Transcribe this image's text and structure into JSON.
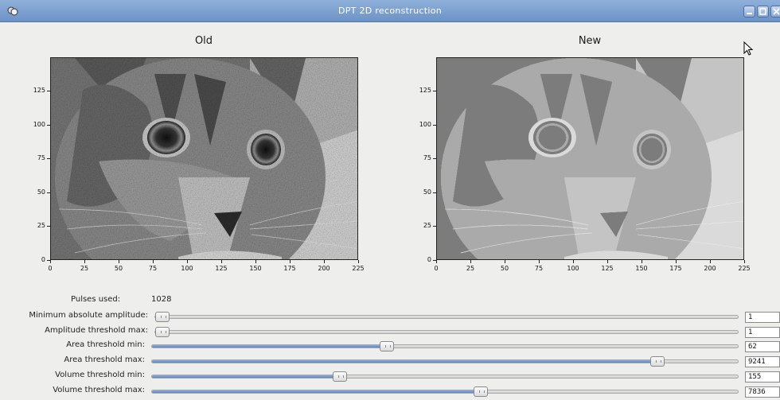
{
  "window": {
    "title": "DPT 2D reconstruction",
    "icons": {
      "app": "app-icon",
      "minimize": "minimize-icon",
      "maximize": "maximize-icon",
      "close": "close-icon"
    }
  },
  "plots": {
    "old": {
      "title": "Old"
    },
    "new": {
      "title": "New"
    },
    "x_ticks": [
      "0",
      "25",
      "50",
      "75",
      "100",
      "125",
      "150",
      "175",
      "200",
      "225"
    ],
    "y_ticks": [
      "0",
      "25",
      "50",
      "75",
      "100",
      "125"
    ]
  },
  "pulses": {
    "label": "Pulses used:",
    "value": "1028"
  },
  "controls": [
    {
      "label": "Minimum absolute amplitude:",
      "value": "1",
      "level": 0.005
    },
    {
      "label": "Amplitude threshold max:",
      "value": "1",
      "level": 0.003
    },
    {
      "label": "Area threshold min:",
      "value": "62",
      "level": 0.4
    },
    {
      "label": "Area threshold max:",
      "value": "9241",
      "level": 0.86
    },
    {
      "label": "Volume threshold min:",
      "value": "155",
      "level": 0.32
    },
    {
      "label": "Volume threshold max:",
      "value": "7836",
      "level": 0.56
    }
  ]
}
